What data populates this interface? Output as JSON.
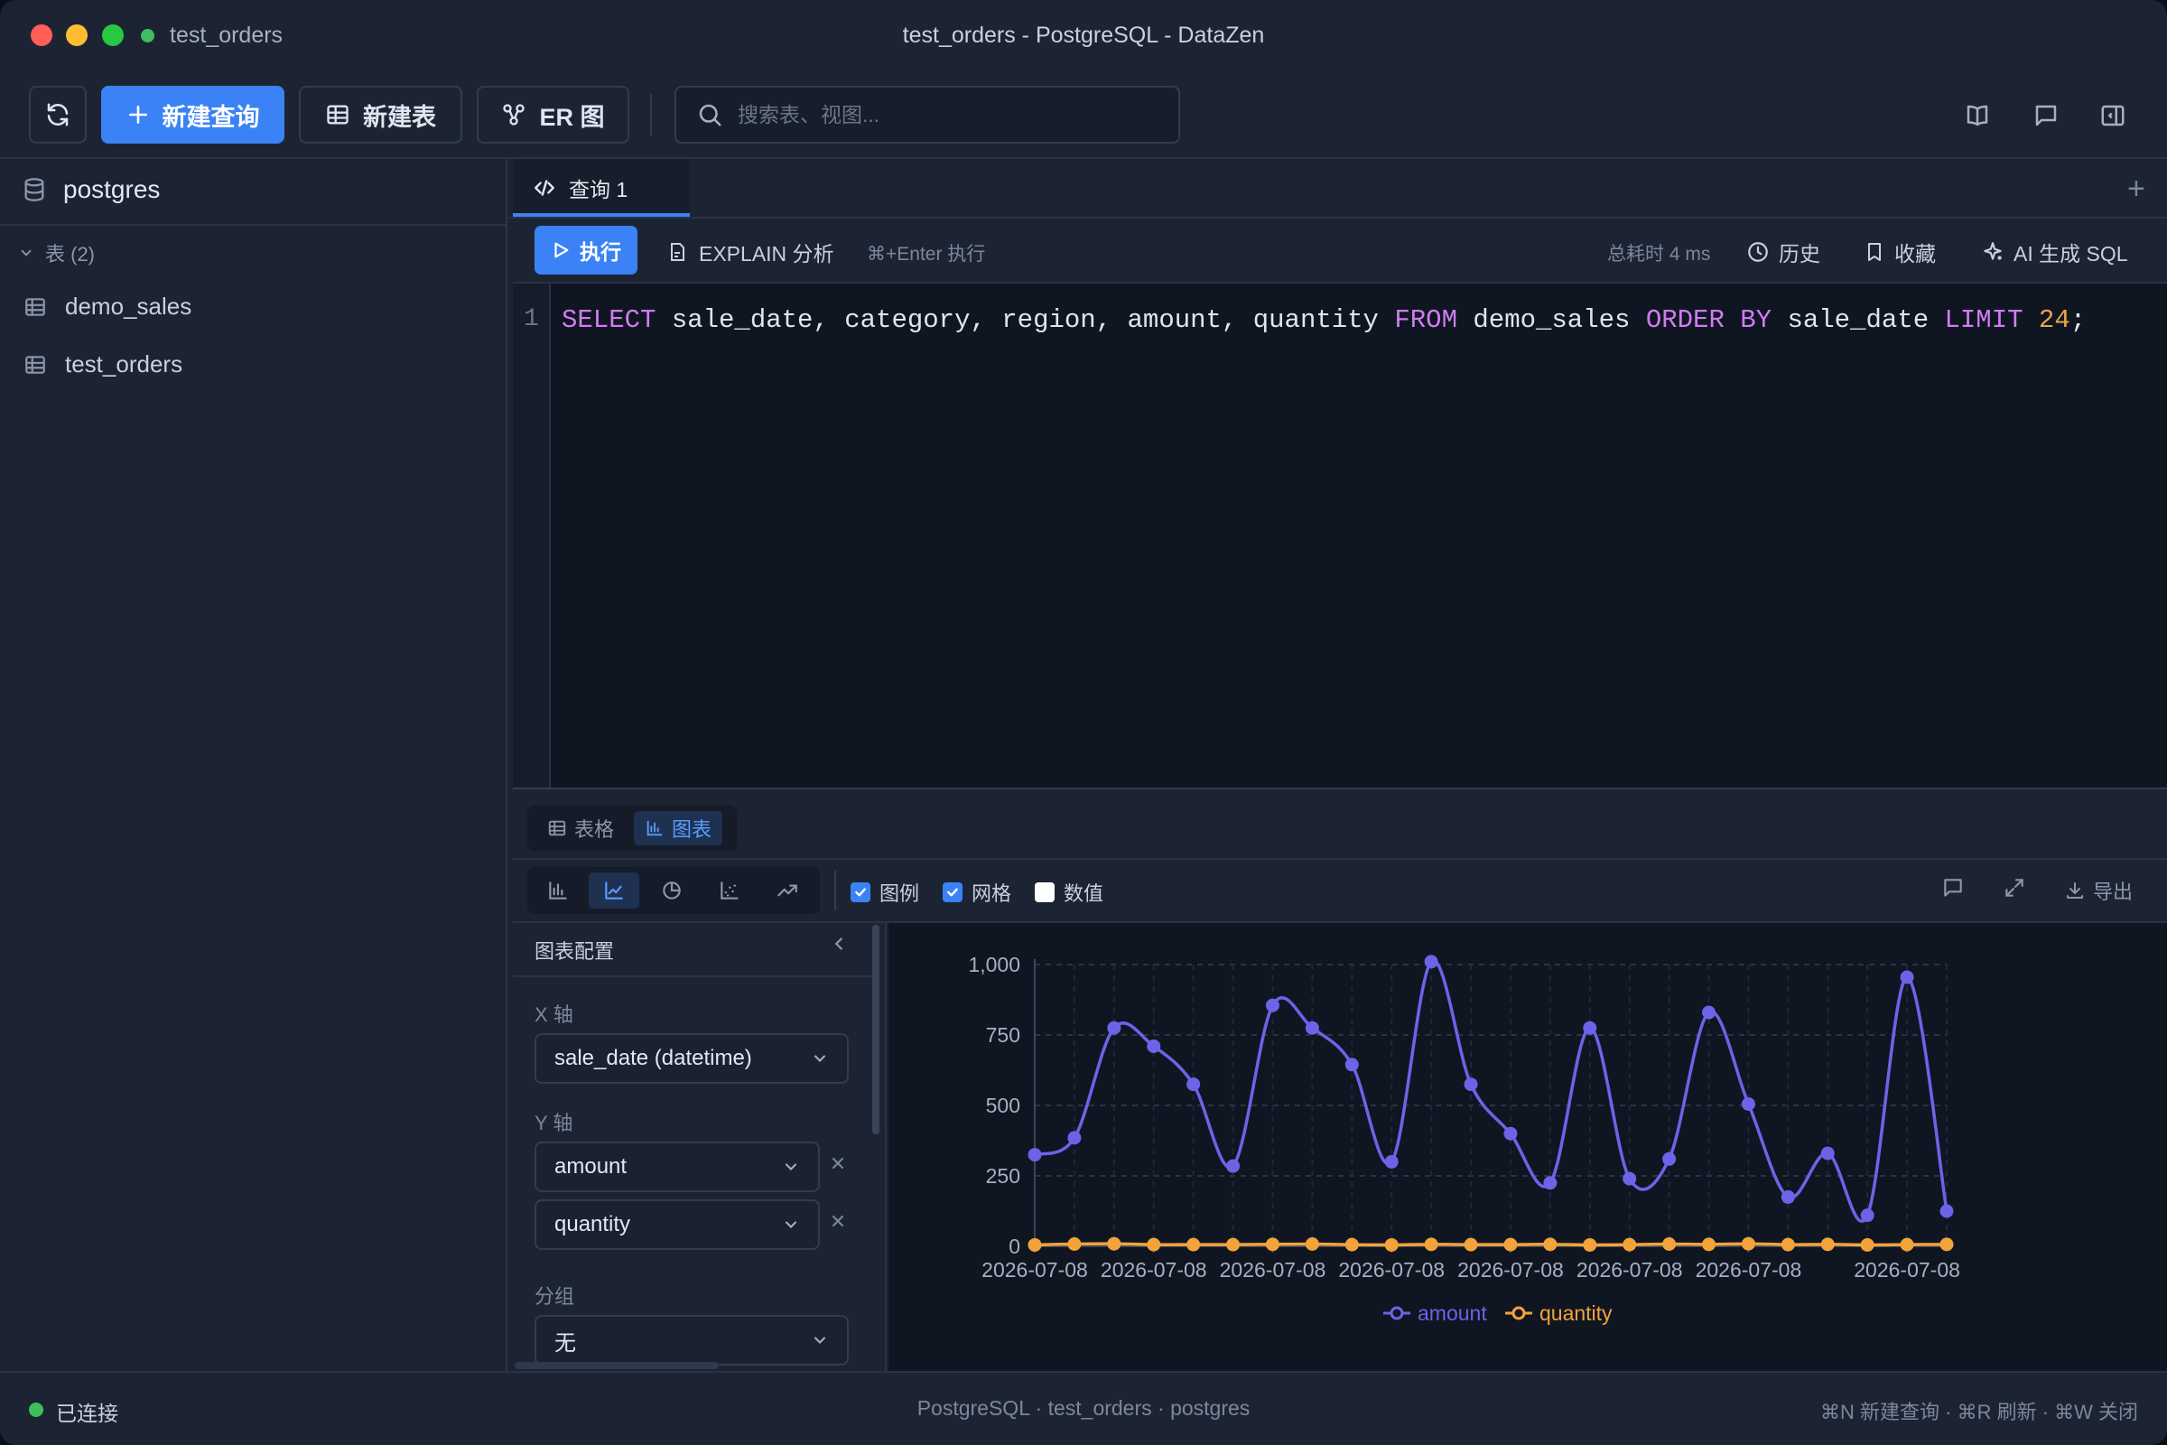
{
  "titlebar": {
    "connection_name": "test_orders",
    "window_title": "test_orders - PostgreSQL - DataZen"
  },
  "toolbar": {
    "new_query_label": "新建查询",
    "new_table_label": "新建表",
    "er_label": "ER 图",
    "search_placeholder": "搜索表、视图..."
  },
  "sidebar": {
    "database": "postgres",
    "section_label": "表 (2)",
    "tables": [
      "demo_sales",
      "test_orders"
    ]
  },
  "editor": {
    "tab_label": "查询 1",
    "run_label": "执行",
    "explain_label": "EXPLAIN 分析",
    "shortcut_hint": "⌘+Enter 执行",
    "elapsed": "总耗时 4 ms",
    "history_label": "历史",
    "favorites_label": "收藏",
    "ai_label": "AI 生成 SQL",
    "line_number": "1"
  },
  "results": {
    "tab_table": "表格",
    "tab_chart": "图表",
    "legend_toggle": "图例",
    "grid_toggle": "网格",
    "values_toggle": "数值",
    "export_label": "导出",
    "legend_checked": true,
    "grid_checked": true,
    "values_checked": false
  },
  "config": {
    "title": "图表配置",
    "x_axis_label": "X 轴",
    "x_axis_value": "sale_date (datetime)",
    "y_axis_label": "Y 轴",
    "y_fields": [
      "amount",
      "quantity"
    ],
    "group_label": "分组",
    "group_value": "无"
  },
  "statusbar": {
    "status": "已连接",
    "info": "PostgreSQL · test_orders · postgres",
    "shortcuts": "⌘N 新建查询 · ⌘R 刷新 · ⌘W 关闭"
  },
  "colors": {
    "accent": "#3b82f6",
    "amount_series": "#6b64e8",
    "quantity_series": "#f2a33a",
    "connected": "#3fbf5a"
  },
  "chart_data": {
    "type": "line",
    "x_tick_labels": [
      "2026-07-08",
      "2026-07-08",
      "2026-07-08",
      "2026-07-08",
      "2026-07-08",
      "2026-07-08",
      "2026-07-08",
      "2026-07-08"
    ],
    "ylim": [
      0,
      1000
    ],
    "yticks": [
      0,
      250,
      500,
      750,
      1000
    ],
    "ytick_labels": [
      "0",
      "250",
      "500",
      "750",
      "1,000"
    ],
    "grid": true,
    "legend_position": "bottom-center",
    "series": [
      {
        "name": "amount",
        "values": [
          325,
          385,
          775,
          710,
          575,
          285,
          855,
          775,
          645,
          300,
          1010,
          575,
          400,
          225,
          775,
          240,
          310,
          830,
          505,
          175,
          330,
          110,
          955,
          125
        ]
      },
      {
        "name": "quantity",
        "values": [
          5,
          8,
          9,
          6,
          6,
          6,
          7,
          8,
          6,
          5,
          7,
          6,
          6,
          7,
          5,
          6,
          8,
          7,
          9,
          6,
          7,
          5,
          6,
          7
        ]
      }
    ]
  }
}
